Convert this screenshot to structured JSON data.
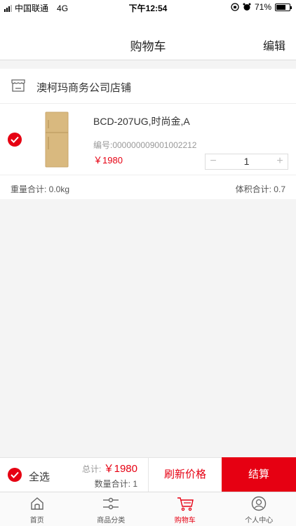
{
  "status_bar": {
    "carrier": "中国联通",
    "network": "4G",
    "time": "下午12:54",
    "battery": "71%",
    "battery_level": 0.71
  },
  "nav": {
    "title": "购物车",
    "edit_label": "编辑"
  },
  "store": {
    "name": "澳柯玛商务公司店铺",
    "icon": "store-icon"
  },
  "cart_item": {
    "checked": true,
    "name": "BCD-207UG,时尚金,A",
    "code": "编号:000000009001002212",
    "price": "￥1980",
    "quantity": "1",
    "minus": "−",
    "plus": "+"
  },
  "summary": {
    "weight": "重量合计: 0.0kg",
    "volume": "体积合计: 0.7"
  },
  "action_bar": {
    "select_all_label": "全选",
    "total_label": "总计:",
    "total_amount": "￥1980",
    "count_label": "数量合计: 1",
    "refresh_label": "刷新价格",
    "checkout_label": "结算"
  },
  "tabs": [
    {
      "label": "首页",
      "icon": "home-icon"
    },
    {
      "label": "商品分类",
      "icon": "category-icon"
    },
    {
      "label": "购物车",
      "icon": "cart-icon",
      "active": true
    },
    {
      "label": "个人中心",
      "icon": "user-icon"
    }
  ],
  "colors": {
    "accent": "#e60012",
    "product": "#d9b97f"
  }
}
